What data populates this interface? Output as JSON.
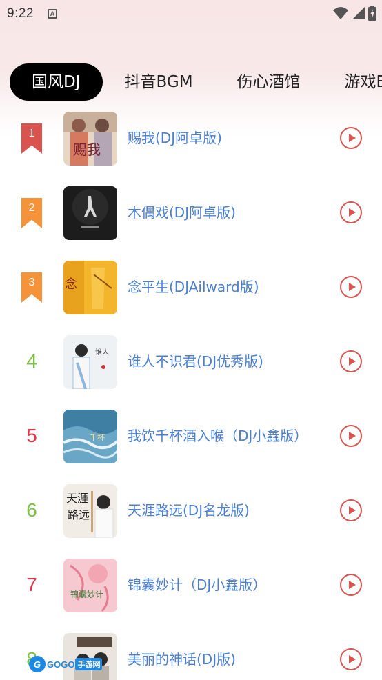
{
  "status_bar": {
    "time": "9:22",
    "notification_icon": "a-letter-icon",
    "icons": [
      "wifi-icon",
      "signal-icon",
      "battery-charging-icon"
    ]
  },
  "tabs": [
    {
      "label": "国风DJ",
      "active": true
    },
    {
      "label": "抖音BGM",
      "active": false
    },
    {
      "label": "伤心酒馆",
      "active": false
    },
    {
      "label": "游戏BGM",
      "active": false
    }
  ],
  "songs": [
    {
      "rank": "1",
      "title": "赐我(DJ阿卓版)",
      "rank_style": "ribbon",
      "rank_color": "#d9534f"
    },
    {
      "rank": "2",
      "title": "木偶戏(DJ阿卓版)",
      "rank_style": "ribbon",
      "rank_color": "#f5933a"
    },
    {
      "rank": "3",
      "title": "念平生(DJAilward版)",
      "rank_style": "ribbon",
      "rank_color": "#f5933a"
    },
    {
      "rank": "4",
      "title": "谁人不识君(DJ优秀版)",
      "rank_style": "number",
      "rank_color": "#7cc242"
    },
    {
      "rank": "5",
      "title": "我饮千杯酒入喉（DJ小鑫版）",
      "rank_style": "number",
      "rank_color": "#e0364a"
    },
    {
      "rank": "6",
      "title": "天涯路远(DJ名龙版)",
      "rank_style": "number",
      "rank_color": "#7cc242"
    },
    {
      "rank": "7",
      "title": "锦囊妙计（DJ小鑫版）",
      "rank_style": "number",
      "rank_color": "#e0364a"
    },
    {
      "rank": "8",
      "title": "美丽的神话(DJ版)",
      "rank_style": "number",
      "rank_color": "#7cc242"
    }
  ],
  "watermark": {
    "brand": "GOGO",
    "suffix": "手游网"
  },
  "colors": {
    "title": "#4a7fd1",
    "play": "#d9534f",
    "active_tab_bg": "#000000"
  }
}
